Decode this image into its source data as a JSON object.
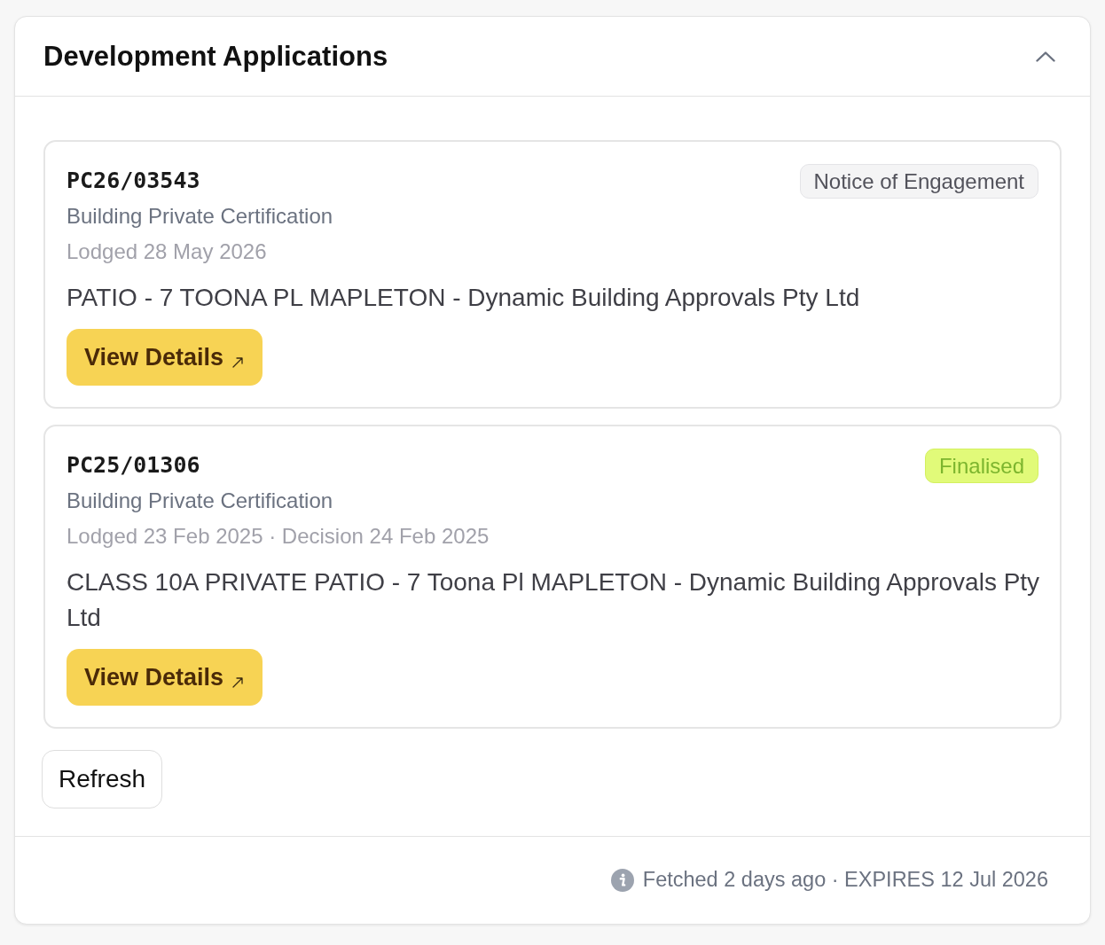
{
  "panel": {
    "title": "Development Applications",
    "expanded": true
  },
  "applications": [
    {
      "reference": "PC26/03543",
      "status": {
        "label": "Notice of Engagement",
        "kind": "neutral"
      },
      "type": "Building Private Certification",
      "dates": "Lodged 28 May 2026",
      "description": "PATIO - 7 TOONA PL MAPLETON - Dynamic Building Approvals Pty Ltd",
      "action": "View Details"
    },
    {
      "reference": "PC25/01306",
      "status": {
        "label": "Finalised",
        "kind": "success"
      },
      "type": "Building Private Certification",
      "dates": "Lodged 23 Feb 2025 · Decision 24 Feb 2025",
      "description": "CLASS 10A PRIVATE PATIO - 7 Toona Pl MAPLETON - Dynamic Building Approvals Pty Ltd",
      "action": "View Details"
    }
  ],
  "refresh_button": "Refresh",
  "footer": {
    "text": "Fetched 2 days ago · EXPIRES 12 Jul 2026"
  }
}
